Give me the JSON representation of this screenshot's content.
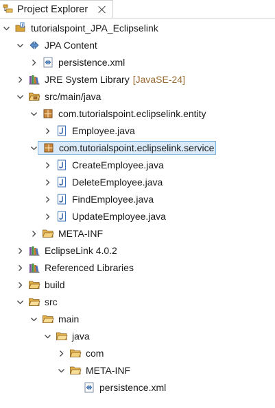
{
  "view": {
    "title": "Project Explorer"
  },
  "tree": [
    {
      "label": "tutorialspoint_JPA_Eclipselink",
      "depth": 0,
      "icon": "java-project-icon",
      "expanded": true
    },
    {
      "label": "JPA Content",
      "depth": 1,
      "icon": "jpa-content-icon",
      "expanded": true
    },
    {
      "label": "persistence.xml",
      "depth": 2,
      "icon": "xml-file-icon",
      "expanded": false
    },
    {
      "label": "JRE System Library",
      "decoration": "[JavaSE-24]",
      "depth": 1,
      "icon": "library-icon",
      "expanded": false
    },
    {
      "label": "src/main/java",
      "depth": 1,
      "icon": "source-folder-icon",
      "expanded": true
    },
    {
      "label": "com.tutorialspoint.eclipselink.entity",
      "depth": 2,
      "icon": "package-icon",
      "expanded": true
    },
    {
      "label": "Employee.java",
      "depth": 3,
      "icon": "java-file-icon",
      "expanded": false
    },
    {
      "label": "com.tutorialspoint.eclipselink.service",
      "depth": 2,
      "icon": "package-icon",
      "expanded": true,
      "selected": true
    },
    {
      "label": "CreateEmployee.java",
      "depth": 3,
      "icon": "java-file-icon",
      "expanded": false
    },
    {
      "label": "DeleteEmployee.java",
      "depth": 3,
      "icon": "java-file-icon",
      "expanded": false
    },
    {
      "label": "FindEmployee.java",
      "depth": 3,
      "icon": "java-file-icon",
      "expanded": false
    },
    {
      "label": "UpdateEmployee.java",
      "depth": 3,
      "icon": "java-file-icon",
      "expanded": false
    },
    {
      "label": "META-INF",
      "depth": 2,
      "icon": "folder-icon",
      "expanded": false
    },
    {
      "label": "EclipseLink 4.0.2",
      "depth": 1,
      "icon": "library-icon",
      "expanded": false
    },
    {
      "label": "Referenced Libraries",
      "depth": 1,
      "icon": "library-icon",
      "expanded": false
    },
    {
      "label": "build",
      "depth": 1,
      "icon": "folder-icon",
      "expanded": false
    },
    {
      "label": "src",
      "depth": 1,
      "icon": "folder-open-icon",
      "expanded": true
    },
    {
      "label": "main",
      "depth": 2,
      "icon": "folder-open-icon",
      "expanded": true
    },
    {
      "label": "java",
      "depth": 3,
      "icon": "folder-open-icon",
      "expanded": true
    },
    {
      "label": "com",
      "depth": 4,
      "icon": "folder-icon",
      "expanded": false
    },
    {
      "label": "META-INF",
      "depth": 4,
      "icon": "folder-open-icon",
      "expanded": true
    },
    {
      "label": "persistence.xml",
      "depth": 5,
      "icon": "xml-file-icon",
      "leaf": true
    }
  ]
}
